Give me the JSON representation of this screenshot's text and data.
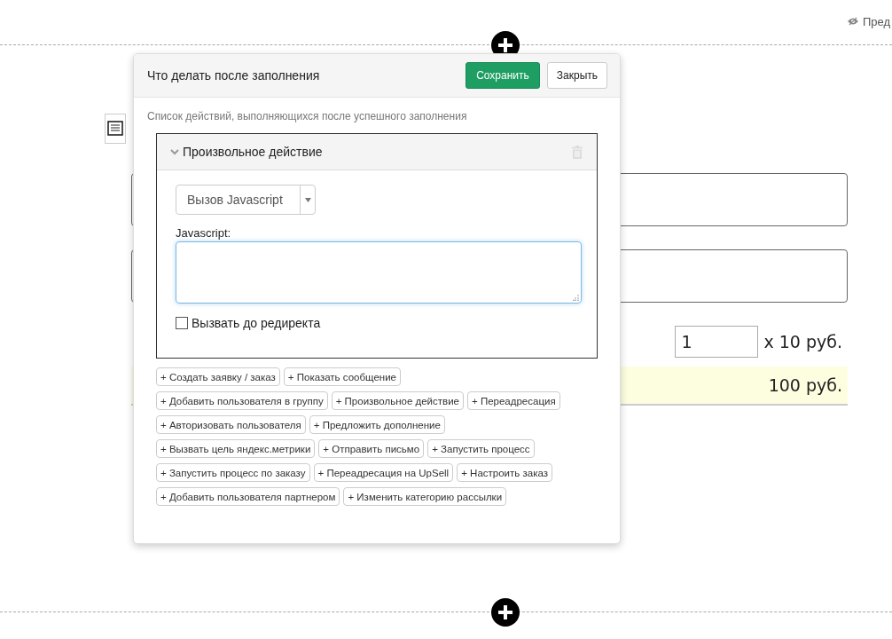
{
  "preview_link": "Пред",
  "form": {
    "fields": [
      {
        "kind": "input"
      },
      {
        "kind": "input"
      }
    ],
    "quantity": "1",
    "price": "x 10 руб.",
    "total": "100 руб."
  },
  "modal": {
    "title": "Что делать после заполнения",
    "save_button": "Сохранить",
    "close_button": "Закрыть",
    "description": "Список действий, выполняющихся после успешного заполнения",
    "action": {
      "title": "Произвольное действие",
      "expanded": true,
      "select_value": "Вызов Javascript",
      "field_label": "Javascript:",
      "checkbox": {
        "label": "Вызвать до редиректа",
        "checked": false
      }
    },
    "add_button_rows": [
      [
        "+ Создать заявку / заказ",
        "+ Показать сообщение"
      ],
      [
        "+ Добавить пользователя в группу",
        "+ Произвольное действие",
        "+ Переадресация"
      ],
      [
        "+ Авторизовать пользователя",
        "+ Предложить дополнение"
      ],
      [
        "+ Вызвать цель яндекс.метрики",
        "+ Отправить письмо",
        "+ Запустить процесс"
      ],
      [
        "+ Запустить процесс по заказу",
        "+ Переадресация на UpSell",
        "+ Настроить заказ"
      ],
      [
        "+ Добавить пользователя партнером",
        "+ Изменить категорию рассылки"
      ]
    ]
  }
}
